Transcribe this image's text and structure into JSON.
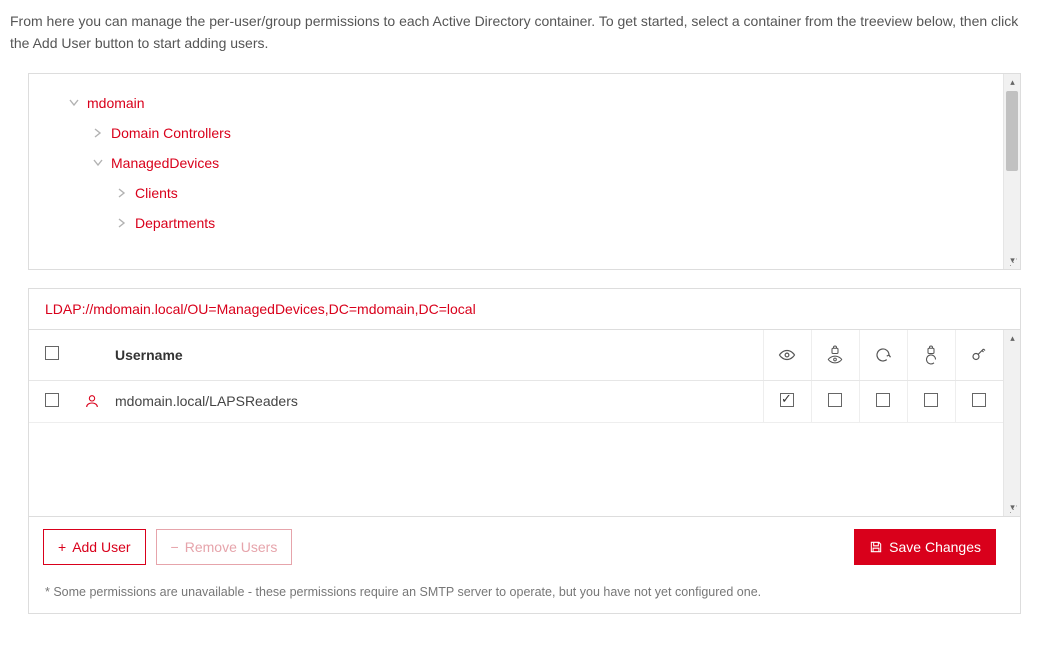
{
  "intro": "From here you can manage the per-user/group permissions to each Active Directory container. To get started, select a container from the treeview below, then click the Add User button to start adding users.",
  "tree": {
    "root": {
      "label": "mdomain",
      "expanded": true,
      "children": [
        {
          "label": "Domain Controllers",
          "expanded": false
        },
        {
          "label": "ManagedDevices",
          "expanded": true,
          "children": [
            {
              "label": "Clients",
              "expanded": false
            },
            {
              "label": "Departments",
              "expanded": false
            }
          ]
        }
      ]
    }
  },
  "ldap_path": "LDAP://mdomain.local/OU=ManagedDevices,DC=mdomain,DC=local",
  "table": {
    "headers": {
      "username": "Username"
    },
    "rows": [
      {
        "username": "mdomain.local/LAPSReaders",
        "selected": false,
        "perms": [
          true,
          false,
          false,
          false,
          false
        ]
      }
    ]
  },
  "buttons": {
    "add_user": "Add User",
    "remove_users": "Remove Users",
    "save": "Save Changes"
  },
  "footnote": "* Some permissions are unavailable - these permissions require an SMTP server to operate, but you have not yet configured one."
}
